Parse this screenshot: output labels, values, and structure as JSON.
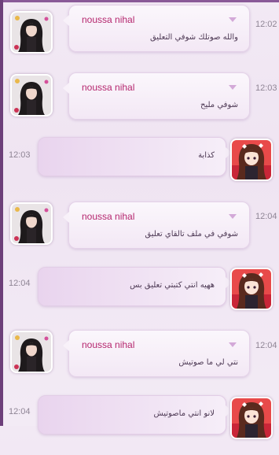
{
  "chat": {
    "messages": [
      {
        "kind": "other",
        "sender": "noussa nihal",
        "text": "والله صوتلك شوفي التعليق",
        "time": "12:02"
      },
      {
        "kind": "other",
        "sender": "noussa nihal",
        "text": "شوفي مليح",
        "time": "12:03"
      },
      {
        "kind": "mine",
        "text": "كذابة",
        "time": "12:03"
      },
      {
        "kind": "other",
        "sender": "noussa nihal",
        "text": "شوفي في ملف تالقاي تعليق",
        "time": "12:04"
      },
      {
        "kind": "mine",
        "text": "ههيه انتي كتبتي تعليق بس",
        "time": "12:04"
      },
      {
        "kind": "other",
        "sender": "noussa nihal",
        "text": "نتي لي ما صوتيش",
        "time": "12:04"
      },
      {
        "kind": "mine",
        "text": "لانو انتي ماصوتيش",
        "time": "12:04"
      }
    ]
  },
  "colors": {
    "sender": "#b5276e",
    "time": "#8f8595",
    "accent": "#8a5a98"
  },
  "icons": {
    "message_menu": "chevron-down-icon",
    "contact_avatar": "avatar-icon",
    "my_avatar": "avatar-icon"
  }
}
